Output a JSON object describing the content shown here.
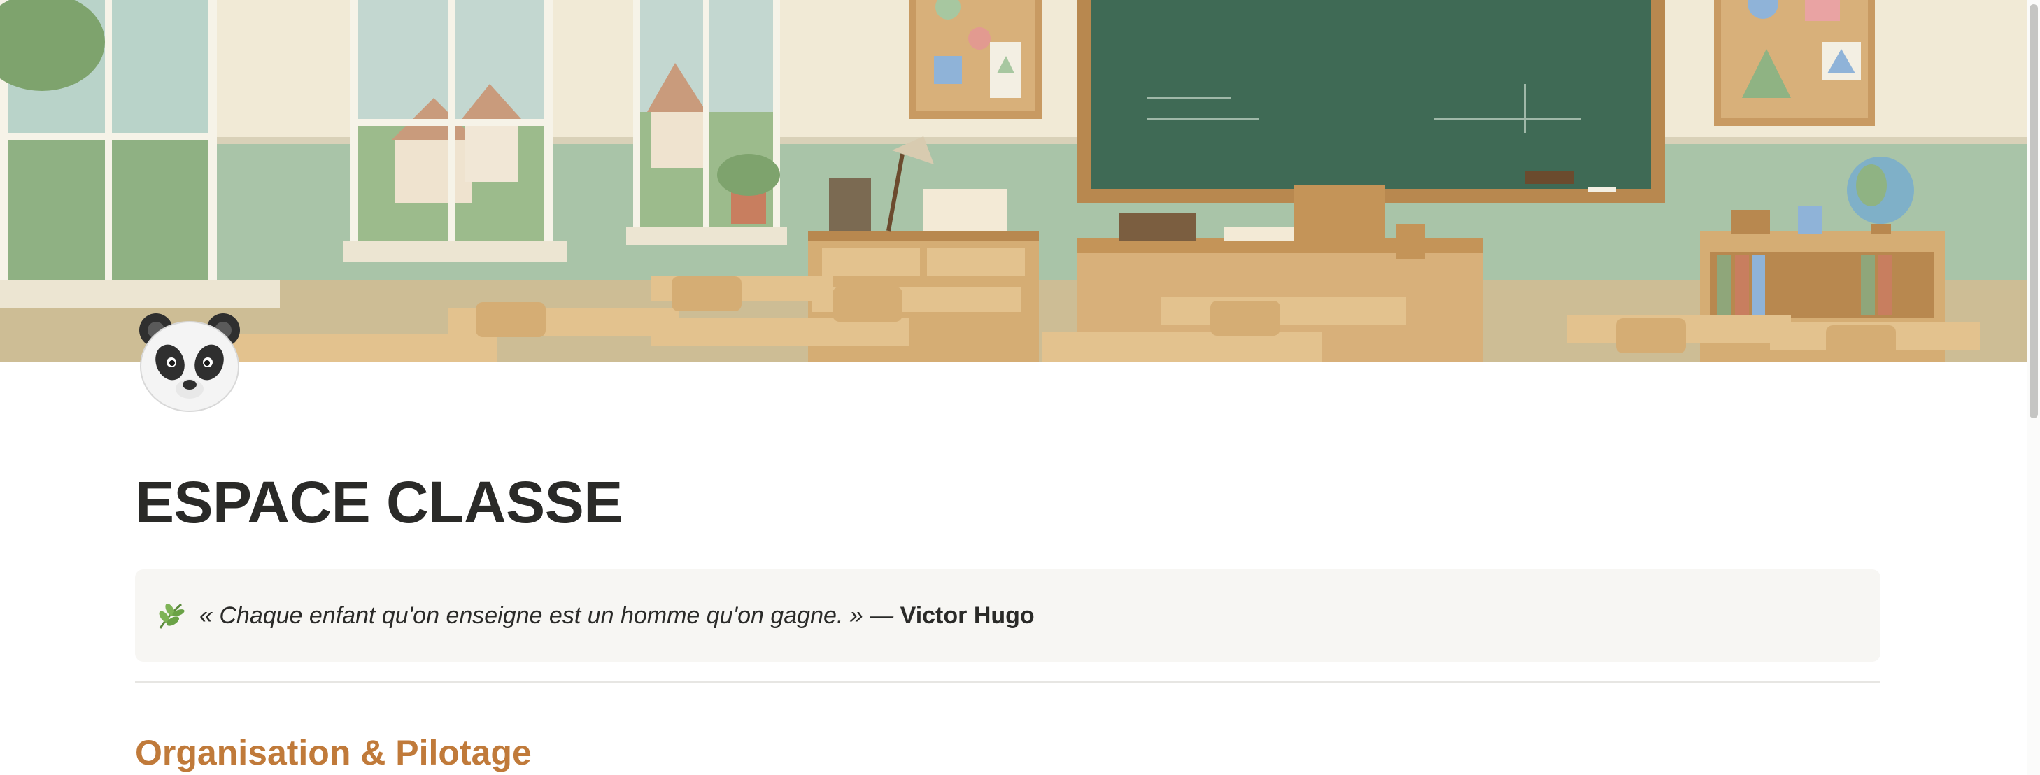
{
  "cover": {
    "description_icon": "classroom-illustration"
  },
  "page": {
    "icon": "panda-icon",
    "title": "ESPACE CLASSE"
  },
  "callout": {
    "icon": "herb-icon",
    "quote": "« Chaque enfant qu'on enseigne est un homme qu'on gagne. » —",
    "author": "Victor Hugo"
  },
  "sections": [
    {
      "heading": "Organisation & Pilotage"
    }
  ],
  "colors": {
    "title": "#2a2a28",
    "section_heading": "#c07a3a",
    "callout_bg": "#f7f6f3",
    "chalkboard": "#3f6a55",
    "wall_green": "#9bbaa0"
  }
}
